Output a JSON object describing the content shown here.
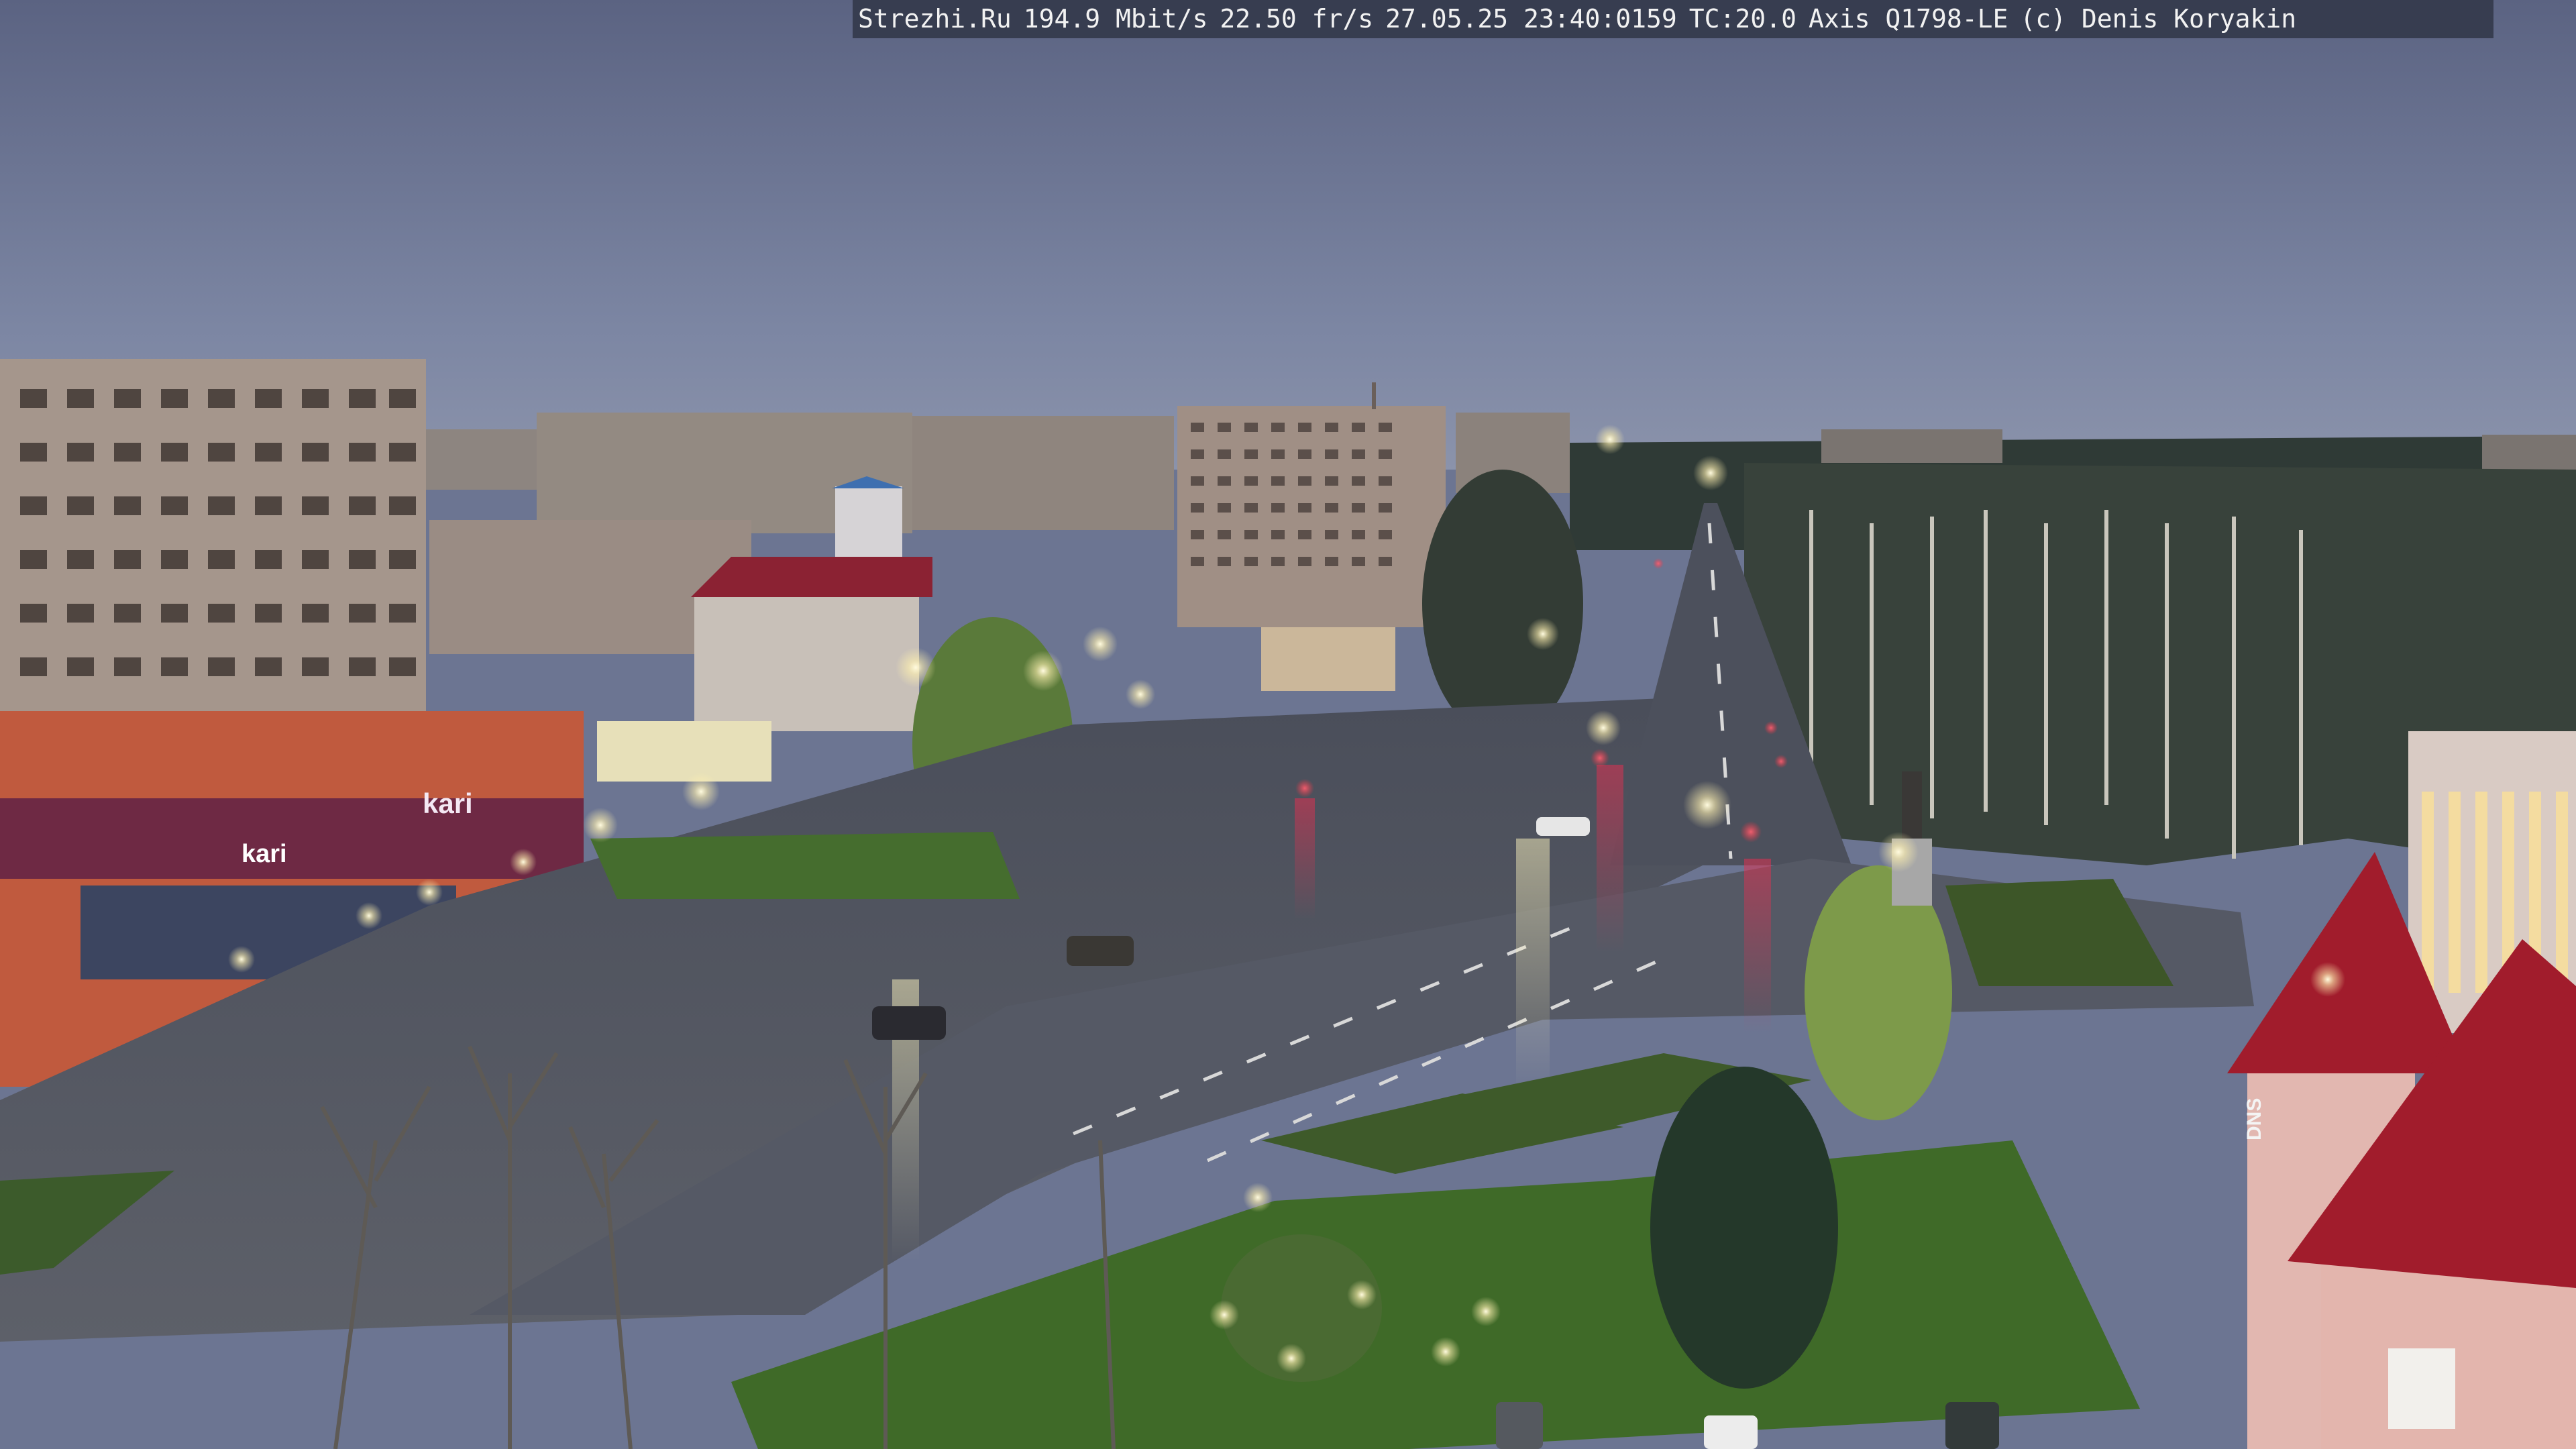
{
  "camera_overlay": {
    "site": "Strezhi.Ru",
    "bitrate": "194.9 Mbit/s",
    "framerate": "22.50 fr/s",
    "datetime": "27.05.25 23:40:0159",
    "tc": "TC:20.0",
    "camera_model": "Axis Q1798-LE",
    "copyright": "(c) Denis Koryakin"
  },
  "storefront_signs": {
    "brand_sign": "kari",
    "dns_sign": "DNS"
  },
  "colors": {
    "sky_top": "#5e6583",
    "sky_horizon": "#8a93ad",
    "overlay_bg": "#343a4c",
    "street_light": "#fff4c8",
    "tail_light": "#ff3b4e",
    "grass": "#3f6b2a",
    "roof_red": "#a11c2c"
  }
}
